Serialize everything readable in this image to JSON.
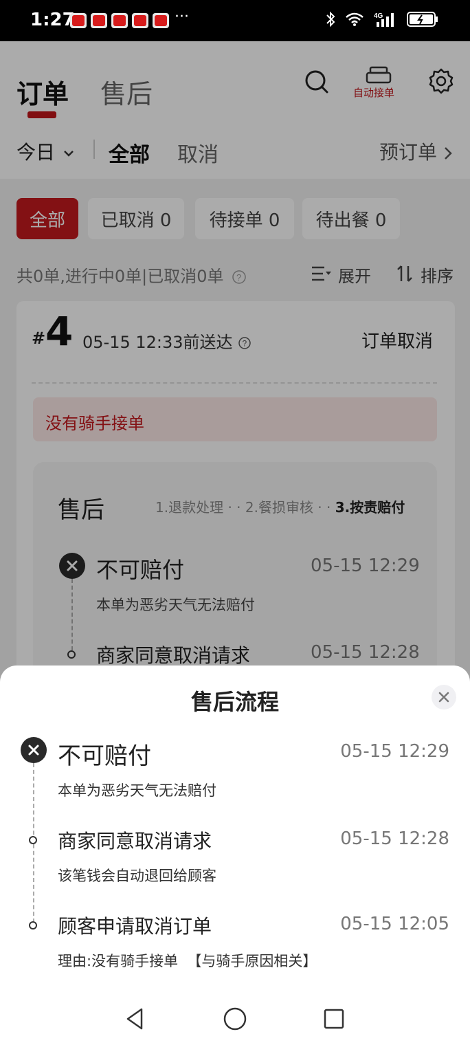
{
  "status_bar": {
    "time": "1:27",
    "more": "···",
    "icons": [
      "bluetooth-icon",
      "wifi-icon",
      "signal-4g-icon",
      "battery-icon"
    ],
    "network": "4G"
  },
  "header": {
    "tabs": [
      {
        "label": "订单",
        "active": true
      },
      {
        "label": "售后",
        "active": false
      }
    ],
    "auto_accept_label": "自动接单",
    "accent_color": "#c0151a"
  },
  "filter_bar": {
    "date_label": "今日",
    "tabs": [
      {
        "label": "全部",
        "active": true
      },
      {
        "label": "取消",
        "active": false
      }
    ],
    "preorder_label": "预订单"
  },
  "chips": [
    {
      "label": "全部",
      "active": true
    },
    {
      "label": "已取消 0",
      "active": false
    },
    {
      "label": "待接单 0",
      "active": false
    },
    {
      "label": "待出餐 0",
      "active": false
    }
  ],
  "summary": {
    "text": "共0单,进行中0单|已取消0单",
    "expand_label": "展开",
    "sort_label": "排序"
  },
  "order": {
    "hash": "#",
    "number": "4",
    "deliver_time": "05-15 12:33前送达",
    "status": "订单取消",
    "warning": "没有骑手接单",
    "after_sale": {
      "title": "售后",
      "steps_prefix": "1.退款处理 · · 2.餐损审核 · · ",
      "steps_current": "3.按责赔付",
      "events": [
        {
          "title": "不可赔付",
          "time": "05-15 12:29",
          "desc": "本单为恶劣天气无法赔付"
        },
        {
          "title": "商家同意取消请求",
          "time": "05-15 12:28"
        }
      ]
    }
  },
  "sheet": {
    "title": "售后流程",
    "events": [
      {
        "title": "不可赔付",
        "time": "05-15 12:29",
        "desc": "本单为恶劣天气无法赔付",
        "icon": "x-circle-icon"
      },
      {
        "title": "商家同意取消请求",
        "time": "05-15 12:28",
        "desc": "该笔钱会自动退回给顾客",
        "icon": "dot-icon"
      },
      {
        "title": "顾客申请取消订单",
        "time": "05-15 12:05",
        "desc": "理由:没有骑手接单  【与骑手原因相关】",
        "icon": "dot-icon"
      }
    ]
  },
  "nav": {
    "icons": [
      "back-icon",
      "home-icon",
      "recents-icon"
    ]
  }
}
